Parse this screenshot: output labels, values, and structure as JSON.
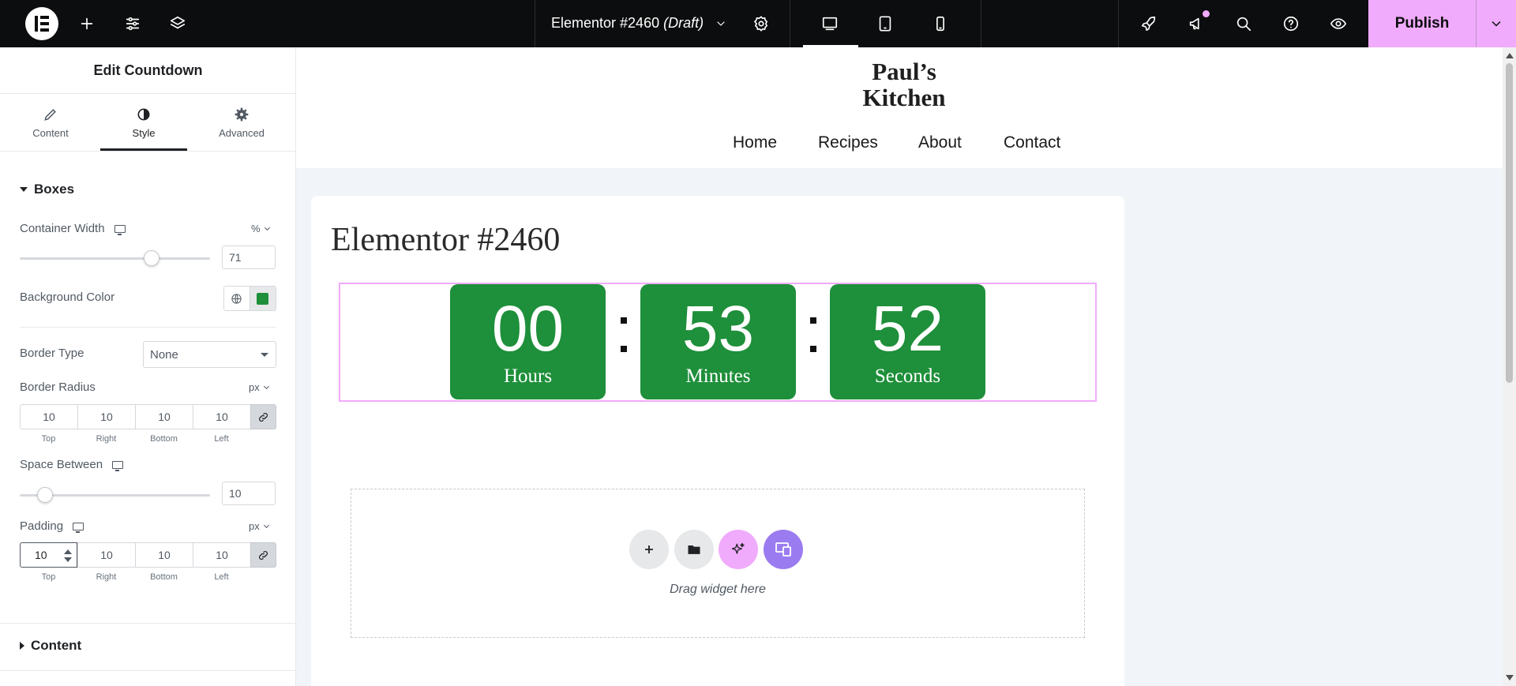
{
  "topbar": {
    "document_title": "Elementor #2460",
    "document_status": "(Draft)",
    "publish_label": "Publish",
    "icons": [
      "elementor-logo-icon",
      "add-element-icon",
      "site-settings-icon",
      "structure-layers-icon",
      "chevron-down-icon",
      "page-settings-gear-icon",
      "desktop-icon",
      "tablet-icon",
      "mobile-icon",
      "rocket-icon",
      "megaphone-icon",
      "search-icon",
      "help-icon",
      "preview-eye-icon"
    ],
    "colors": {
      "background": "#0c0d0e",
      "publish": "#f0abfc"
    }
  },
  "panel": {
    "title": "Edit Countdown",
    "tabs": [
      {
        "label": "Content",
        "icon": "pencil-icon"
      },
      {
        "label": "Style",
        "icon": "half-circle-icon",
        "active": true
      },
      {
        "label": "Advanced",
        "icon": "gear-icon"
      }
    ],
    "boxes_section": "Boxes",
    "container_width": {
      "label": "Container Width",
      "unit": "%",
      "value": "71",
      "level": 0.71
    },
    "background_color": {
      "label": "Background Color",
      "color": "#1e8f3a"
    },
    "border_type": {
      "label": "Border Type",
      "value": "None"
    },
    "border_radius": {
      "label": "Border Radius",
      "unit": "px",
      "top": "10",
      "right": "10",
      "bottom": "10",
      "left": "10"
    },
    "space_between": {
      "label": "Space Between",
      "value": "10",
      "level": 0.1
    },
    "padding": {
      "label": "Padding",
      "unit": "px",
      "top": "10",
      "right": "10",
      "bottom": "10",
      "left": "10"
    },
    "dim_labels": {
      "top": "Top",
      "right": "Right",
      "bottom": "Bottom",
      "left": "Left"
    },
    "content_section": "Content"
  },
  "preview": {
    "site_logo_line1": "Paul’s",
    "site_logo_line2": "Kitchen",
    "nav": [
      "Home",
      "Recipes",
      "About",
      "Contact"
    ],
    "page_title": "Elementor #2460",
    "countdown": [
      {
        "value": "00",
        "label": "Hours"
      },
      {
        "value": "53",
        "label": "Minutes"
      },
      {
        "value": "52",
        "label": "Seconds"
      }
    ],
    "drop_text": "Drag widget here",
    "colors": {
      "box": "#1e8f3a",
      "selection": "#f0abfc",
      "ai_button": "#f0abfc",
      "template_button": "#9b7bf0"
    }
  }
}
